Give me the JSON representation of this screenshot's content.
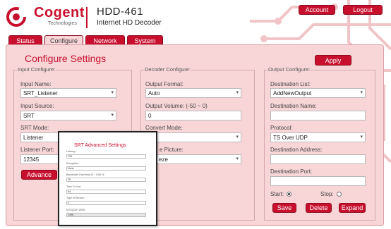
{
  "header": {
    "logo_text": "Cogent",
    "logo_sub": "Technologies",
    "model": "HDD-461",
    "model_sub": "Internet HD Decoder",
    "account_label": "Account",
    "logout_label": "Logout"
  },
  "tabs": [
    {
      "label": "Status",
      "active": false
    },
    {
      "label": "Configure",
      "active": true
    },
    {
      "label": "Network",
      "active": false
    },
    {
      "label": "System",
      "active": false
    }
  ],
  "page": {
    "title": "Configure Settings",
    "apply_label": "Apply"
  },
  "input_configure": {
    "title": "Input Configure:",
    "name_label": "Input Name:",
    "name_value": "SRT_Listener",
    "source_label": "Input Source:",
    "source_value": "SRT",
    "mode_label": "SRT Mode:",
    "mode_value": "Listener",
    "port_label": "Listener Port:",
    "port_value": "12345",
    "advance_label": "Advance"
  },
  "decoder_configure": {
    "title": "Decoder Configure:",
    "format_label": "Output Format:",
    "format_value": "Auto",
    "volume_label": "Output Volume: (-50 ~ 0)",
    "volume_value": "0",
    "convert_label": "Convert Mode:",
    "convert_value": "",
    "picture_label_partial": "e Picture:",
    "picture_value_partial": "eze"
  },
  "output_configure": {
    "title": "Output Configure:",
    "dest_list_label": "Destination List:",
    "dest_list_value": "AddNewOutput",
    "dest_name_label": "Destination Name:",
    "dest_name_value": "",
    "protocol_label": "Protocol:",
    "protocol_value": "TS Over UDP",
    "dest_addr_label": "Destination Address:",
    "dest_addr_value": "",
    "dest_port_label": "Destination Port:",
    "dest_port_value": "",
    "start_label": "Start:",
    "stop_label": "Stop:",
    "start_selected": true,
    "save_label": "Save",
    "delete_label": "Delete",
    "expand_label": "Expand"
  },
  "srt_popup": {
    "title": "SRT Advanced Settings",
    "latency_label": "Latency:",
    "latency_value": "125",
    "encryption_label": "Encryption:",
    "encryption_value": "None",
    "bandwidth_label": "Bandwidth Overhead (5 ~ 100) %:",
    "bandwidth_value": "25",
    "ttl_label": "Time To Live:",
    "ttl_value": "64",
    "tos_label": "Type of Service:",
    "tos_value": "0",
    "mtu_label": "MTU(228~1500):",
    "mtu_value": "1496"
  },
  "colors": {
    "brand_red": "#c8102e",
    "panel_pink": "#f8d6d8"
  }
}
